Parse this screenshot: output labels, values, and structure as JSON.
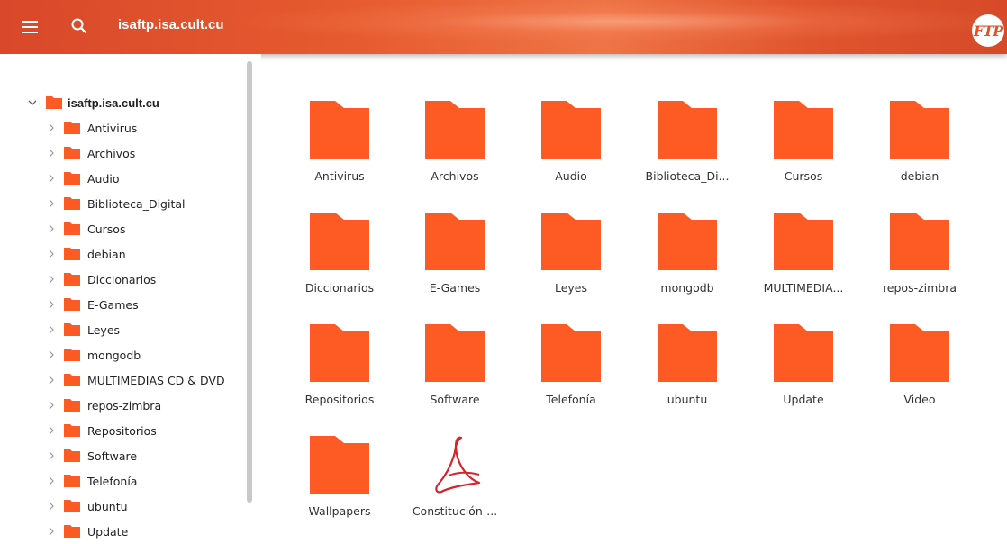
{
  "header": {
    "title": "isaftp.isa.cult.cu",
    "logo_text": "FTP",
    "menu_icon": "hamburger-icon",
    "search_icon": "search-icon"
  },
  "sidebar": {
    "root": {
      "label": "isaftp.isa.cult.cu",
      "expanded": true
    },
    "items": [
      {
        "label": "Antivirus"
      },
      {
        "label": "Archivos"
      },
      {
        "label": "Audio"
      },
      {
        "label": "Biblioteca_Digital"
      },
      {
        "label": "Cursos"
      },
      {
        "label": "debian"
      },
      {
        "label": "Diccionarios"
      },
      {
        "label": "E-Games"
      },
      {
        "label": "Leyes"
      },
      {
        "label": "mongodb"
      },
      {
        "label": "MULTIMEDIAS CD & DVD"
      },
      {
        "label": "repos-zimbra"
      },
      {
        "label": "Repositorios"
      },
      {
        "label": "Software"
      },
      {
        "label": "Telefonía"
      },
      {
        "label": "ubuntu"
      },
      {
        "label": "Update"
      }
    ]
  },
  "main": {
    "items": [
      {
        "label": "Antivirus",
        "type": "folder"
      },
      {
        "label": "Archivos",
        "type": "folder"
      },
      {
        "label": "Audio",
        "type": "folder"
      },
      {
        "label": "Biblioteca_Di...",
        "type": "folder"
      },
      {
        "label": "Cursos",
        "type": "folder"
      },
      {
        "label": "debian",
        "type": "folder"
      },
      {
        "label": "Diccionarios",
        "type": "folder"
      },
      {
        "label": "E-Games",
        "type": "folder"
      },
      {
        "label": "Leyes",
        "type": "folder"
      },
      {
        "label": "mongodb",
        "type": "folder"
      },
      {
        "label": "MULTIMEDIA...",
        "type": "folder"
      },
      {
        "label": "repos-zimbra",
        "type": "folder"
      },
      {
        "label": "Repositorios",
        "type": "folder"
      },
      {
        "label": "Software",
        "type": "folder"
      },
      {
        "label": "Telefonía",
        "type": "folder"
      },
      {
        "label": "ubuntu",
        "type": "folder"
      },
      {
        "label": "Update",
        "type": "folder"
      },
      {
        "label": "Video",
        "type": "folder"
      },
      {
        "label": "Wallpapers",
        "type": "folder"
      },
      {
        "label": "Constitución-...",
        "type": "pdf"
      }
    ]
  },
  "colors": {
    "accent": "#e2522a",
    "folder": "#fd5a24",
    "pdf": "#d8232a"
  }
}
